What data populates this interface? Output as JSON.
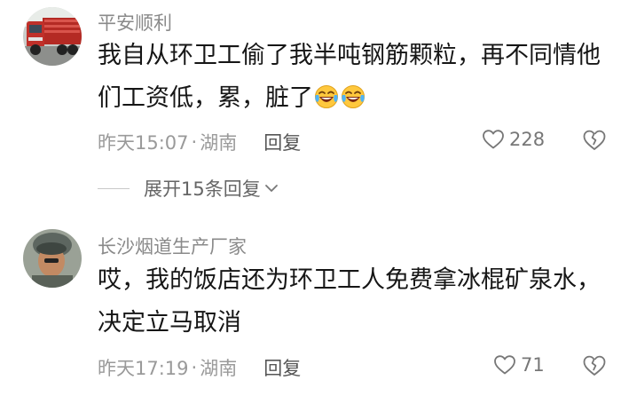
{
  "comments": [
    {
      "username": "平安顺利",
      "content_text": "我自从环卫工偷了我半吨钢筋颗粒，再不同情他们工资低，累，脏了",
      "emoji": [
        "laughing-tears-emoji",
        "laughing-tears-emoji"
      ],
      "time": "昨天15:07",
      "separator": "·",
      "location": "湖南",
      "reply_label": "回复",
      "like_count": "228"
    },
    {
      "username": "长沙烟道生产厂家",
      "content_text": "哎，我的饭店还为环卫工人免费拿冰棍矿泉水，决定立马取消",
      "time": "昨天17:19",
      "separator": "·",
      "location": "湖南",
      "reply_label": "回复",
      "like_count": "71"
    }
  ],
  "expand_replies": {
    "label": "展开15条回复"
  },
  "colors": {
    "username": "#8a8a8a",
    "meta": "#9a9a9a",
    "content": "#161616",
    "emoji_face": "#FFC83D"
  }
}
